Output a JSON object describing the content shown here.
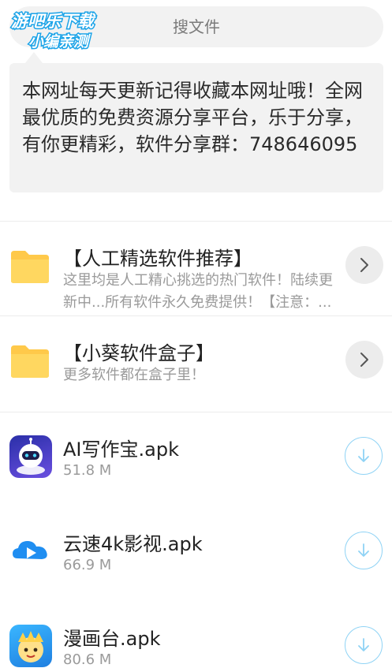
{
  "logo": {
    "line1": "游吧乐下载",
    "line2": "小编亲测"
  },
  "search": {
    "placeholder": "搜文件"
  },
  "notice": {
    "text": "本网址每天更新记得收藏本网址哦！全网最优质的免费资源分享平台，乐于分享，有你更精彩，软件分享群：748646095"
  },
  "folders": [
    {
      "title": "【人工精选软件推荐】",
      "desc": "这里均是人工精心挑选的热门软件！陆续更新中...所有软件永久免费提供！【注意：..."
    },
    {
      "title": "【小葵软件盒子】",
      "desc": "更多软件都在盒子里！"
    }
  ],
  "files": [
    {
      "name": "AI写作宝.apk",
      "size": "51.8 M",
      "icon": "robot-app-icon"
    },
    {
      "name": "云速4k影视.apk",
      "size": "66.9 M",
      "icon": "cloud-play-app-icon"
    },
    {
      "name": "漫画台.apk",
      "size": "80.6 M",
      "icon": "cartoon-app-icon"
    }
  ],
  "colors": {
    "folder": "#FFC94A",
    "download_accent": "#8fd3f5",
    "logo_blue": "#1aa3e8"
  }
}
